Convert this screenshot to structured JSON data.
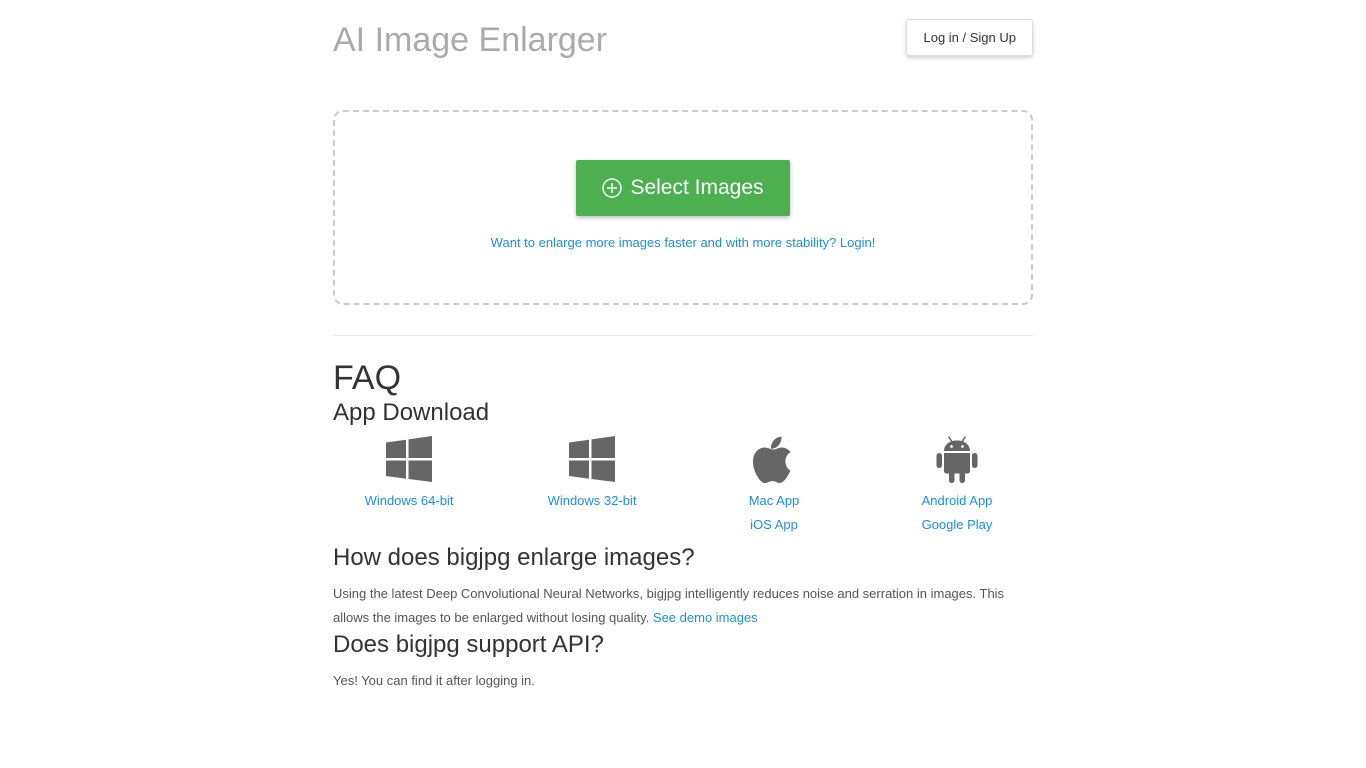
{
  "header": {
    "title": "AI Image Enlarger",
    "login_label": "Log in / Sign Up"
  },
  "upload": {
    "select_label": "Select Images",
    "login_prompt": "Want to enlarge more images faster and with more stability? Login!"
  },
  "faq": {
    "title": "FAQ",
    "app_download": {
      "heading": "App Download",
      "apps": [
        {
          "icon": "windows-icon",
          "links": [
            "Windows 64-bit"
          ]
        },
        {
          "icon": "windows-icon",
          "links": [
            "Windows 32-bit"
          ]
        },
        {
          "icon": "apple-icon",
          "links": [
            "Mac App",
            "iOS App"
          ]
        },
        {
          "icon": "android-icon",
          "links": [
            "Android App",
            "Google Play"
          ]
        }
      ]
    },
    "how": {
      "heading": "How does bigjpg enlarge images?",
      "text": "Using the latest Deep Convolutional Neural Networks, bigjpg intelligently reduces noise and serration in images. This allows the images to be enlarged without losing quality.",
      "link": "See demo images"
    },
    "api": {
      "heading": "Does bigjpg support API?",
      "text": "Yes! You can find it after logging in."
    }
  },
  "colors": {
    "accent_green": "#4caf50",
    "link_blue": "#1e8fd8",
    "title_gray": "#aaaaaa",
    "icon_gray": "#666666"
  }
}
